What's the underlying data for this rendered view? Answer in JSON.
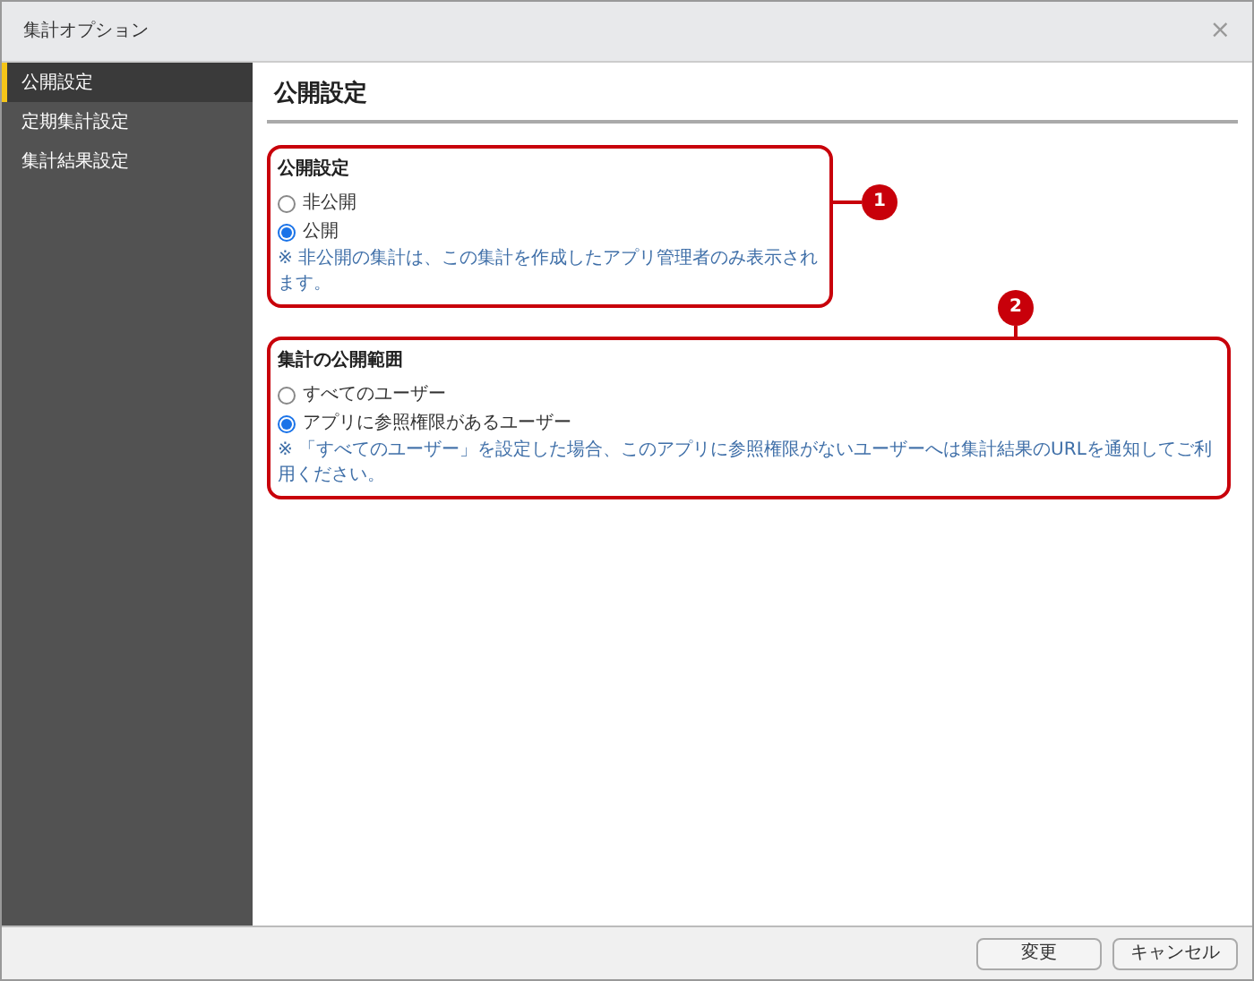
{
  "window": {
    "title": "集計オプション",
    "close": "×"
  },
  "sidebar": {
    "items": [
      {
        "label": "公開設定",
        "selected": true
      },
      {
        "label": "定期集計設定",
        "selected": false
      },
      {
        "label": "集計結果設定",
        "selected": false
      }
    ]
  },
  "section": {
    "title": "公開設定"
  },
  "groups": [
    {
      "title": "公開設定",
      "options": [
        {
          "label": "非公開",
          "selected": false
        },
        {
          "label": "公開",
          "selected": true
        }
      ],
      "note": "※ 非公開の集計は、この集計を作成したアプリ管理者のみ表示されます。",
      "callout": "1"
    },
    {
      "title": "集計の公開範囲",
      "options": [
        {
          "label": "すべてのユーザー",
          "selected": false
        },
        {
          "label": "アプリに参照権限があるユーザー",
          "selected": true
        }
      ],
      "note": "※ 「すべてのユーザー」を設定した場合、このアプリに参照権限がないユーザーへは集計結果のURLを通知してご利用ください。",
      "callout": "2"
    }
  ],
  "buttons": [
    "変更",
    "キャンセル"
  ]
}
